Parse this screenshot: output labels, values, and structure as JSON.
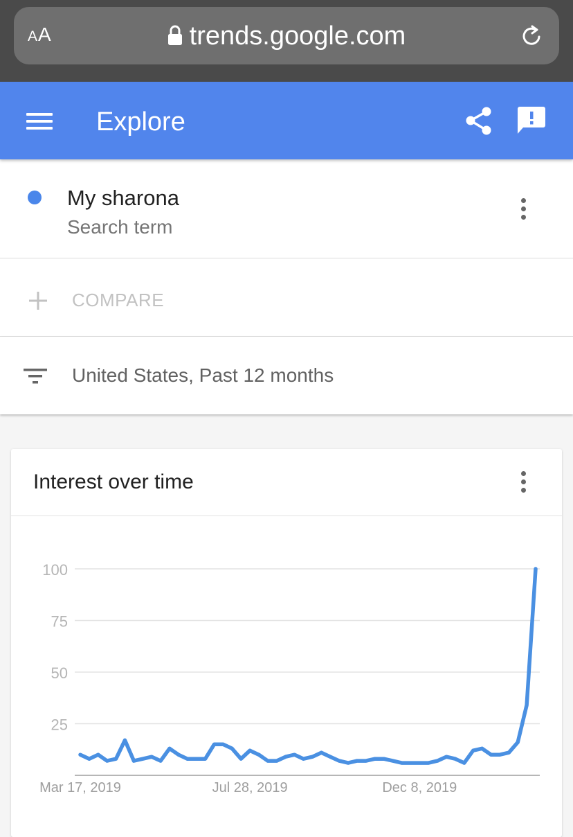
{
  "browser": {
    "text_size_label_small": "A",
    "text_size_label_large": "A",
    "url": "trends.google.com"
  },
  "app_bar": {
    "title": "Explore",
    "color": "#5185ec"
  },
  "term": {
    "name": "My sharona",
    "type": "Search term",
    "color": "#4a86ea"
  },
  "compare": {
    "label": "COMPARE"
  },
  "filter": {
    "label": "United States, Past 12 months"
  },
  "interest_card": {
    "title": "Interest over time"
  },
  "chart_data": {
    "type": "line",
    "title": "Interest over time",
    "xlabel": "",
    "ylabel": "",
    "ylim": [
      0,
      100
    ],
    "yticks": [
      "100",
      "75",
      "50",
      "25"
    ],
    "ytick_values": [
      100,
      75,
      50,
      25
    ],
    "grid": true,
    "x_tick_labels": [
      "Mar 17, 2019",
      "Jul 28, 2019",
      "Dec 8, 2019"
    ],
    "x_tick_indices": [
      0,
      19,
      38
    ],
    "series": [
      {
        "color": "#4a90e2",
        "values": [
          10,
          8,
          10,
          7,
          8,
          17,
          7,
          8,
          9,
          7,
          13,
          10,
          8,
          8,
          8,
          15,
          15,
          13,
          8,
          12,
          10,
          7,
          7,
          9,
          10,
          8,
          9,
          11,
          9,
          7,
          6,
          7,
          7,
          8,
          8,
          7,
          6,
          6,
          6,
          6,
          7,
          9,
          8,
          6,
          12,
          13,
          10,
          10,
          11,
          16,
          34,
          100
        ]
      }
    ]
  }
}
